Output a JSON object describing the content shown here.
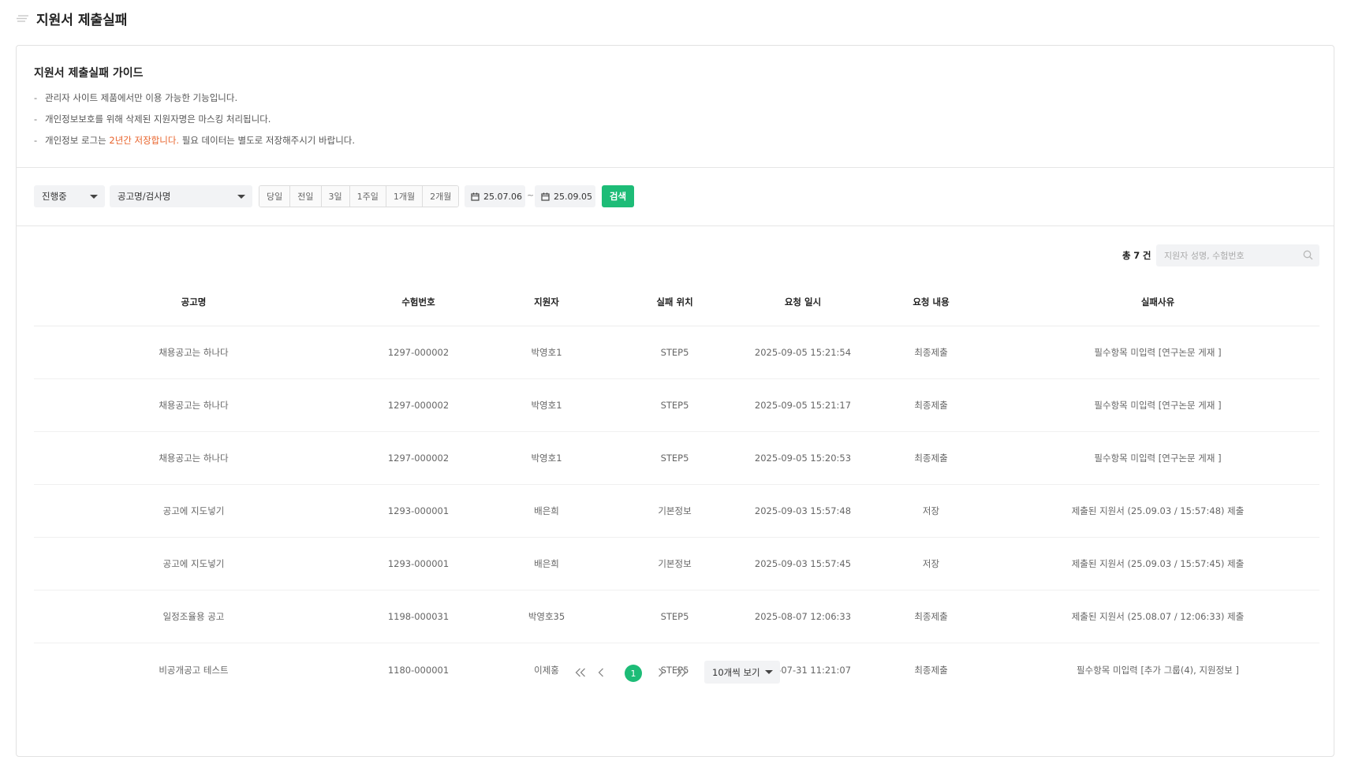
{
  "page": {
    "title": "지원서 제출실패"
  },
  "guide": {
    "title": "지원서 제출실패 가이드",
    "bullet": "-",
    "items": [
      {
        "text": "관리자 사이트 제품에서만 이용 가능한 기능입니다."
      },
      {
        "text": "개인정보보호를 위해 삭제된 지원자명은 마스킹 처리됩니다."
      },
      {
        "before": "개인정보 로그는 ",
        "highlight": "2년간 저장합니다.",
        "after": " 필요 데이터는 별도로 저장해주시기 바랍니다."
      }
    ],
    "highlight_color": "#e8632b"
  },
  "filters": {
    "status_select": "진행중",
    "type_select": "공고명/검사명",
    "ranges": [
      "당일",
      "전일",
      "3일",
      "1주일",
      "1개월",
      "2개월"
    ],
    "date_from": "25.07.06",
    "date_separator": "~",
    "date_to": "25.09.05",
    "search_label": "검색",
    "accent_color": "#1dbc77"
  },
  "summary": {
    "total_prefix": "총",
    "total_count": "7",
    "total_suffix": "건",
    "search_placeholder": "지원자 성명, 수험번호"
  },
  "table": {
    "headers": [
      "공고명",
      "수험번호",
      "지원자",
      "실패 위치",
      "요청 일시",
      "요청 내용",
      "실패사유"
    ],
    "rows": [
      [
        "채용공고는 하나다",
        "1297-000002",
        "박영호1",
        "STEP5",
        "2025-09-05 15:21:54",
        "최종제출",
        "필수항목 미입력 [연구논문 게재 ]"
      ],
      [
        "채용공고는 하나다",
        "1297-000002",
        "박영호1",
        "STEP5",
        "2025-09-05 15:21:17",
        "최종제출",
        "필수항목 미입력 [연구논문 게재 ]"
      ],
      [
        "채용공고는 하나다",
        "1297-000002",
        "박영호1",
        "STEP5",
        "2025-09-05 15:20:53",
        "최종제출",
        "필수항목 미입력 [연구논문 게재 ]"
      ],
      [
        "공고에 지도넣기",
        "1293-000001",
        "배은희",
        "기본정보",
        "2025-09-03 15:57:48",
        "저장",
        "제출된 지원서 (25.09.03 / 15:57:48) 제출"
      ],
      [
        "공고에 지도넣기",
        "1293-000001",
        "배은희",
        "기본정보",
        "2025-09-03 15:57:45",
        "저장",
        "제출된 지원서 (25.09.03 / 15:57:45) 제출"
      ],
      [
        "일정조율용 공고",
        "1198-000031",
        "박영호35",
        "STEP5",
        "2025-08-07 12:06:33",
        "최종제출",
        "제출된 지원서 (25.08.07 / 12:06:33) 제출"
      ],
      [
        "비공개공고 테스트",
        "1180-000001",
        "이제홍",
        "STEP5",
        "2025-07-31 11:21:07",
        "최종제출",
        "필수항목 미입력 [추가 그룹(4), 지원정보 ]"
      ]
    ]
  },
  "pagination": {
    "current_page": "1",
    "per_page": "10개씩 보기",
    "icons": [
      "first-page-icon",
      "prev-page-icon",
      "next-page-icon",
      "last-page-icon"
    ]
  }
}
